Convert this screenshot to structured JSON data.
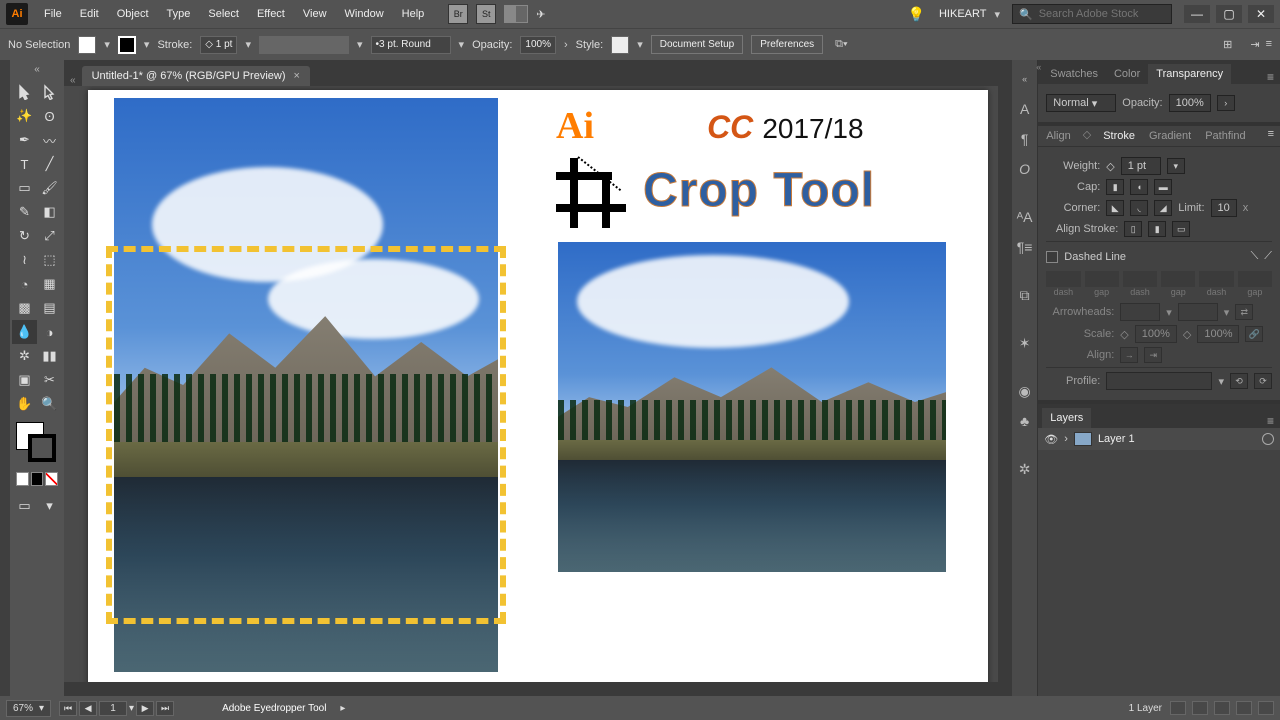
{
  "app": {
    "logo": "Ai"
  },
  "menu": [
    "File",
    "Edit",
    "Object",
    "Type",
    "Select",
    "Effect",
    "View",
    "Window",
    "Help"
  ],
  "user": "HIKEART",
  "search_placeholder": "Search Adobe Stock",
  "controlbar": {
    "selection": "No Selection",
    "stroke_label": "Stroke:",
    "stroke_val": "1 pt",
    "brush": "3 pt. Round",
    "opacity_label": "Opacity:",
    "opacity_val": "100%",
    "style_label": "Style:",
    "doc_setup": "Document Setup",
    "prefs": "Preferences"
  },
  "doc_tab": "Untitled-1* @ 67% (RGB/GPU Preview)",
  "artboard_text": {
    "ai": "Ai",
    "cc": "CC",
    "year": "2017/18",
    "crop_tool": "Crop Tool"
  },
  "status": {
    "zoom": "67%",
    "page": "1",
    "tool": "Adobe Eyedropper Tool",
    "layer_count": "1 Layer"
  },
  "panel_tabs_top": [
    "Swatches",
    "Color",
    "Transparency"
  ],
  "transparency": {
    "mode": "Normal",
    "opacity_label": "Opacity:",
    "opacity_val": "100%"
  },
  "stroke_sub_tabs": [
    "Align",
    "Stroke",
    "Gradient",
    "Pathfind"
  ],
  "stroke_panel": {
    "weight_label": "Weight:",
    "weight_val": "1 pt",
    "cap_label": "Cap:",
    "corner_label": "Corner:",
    "limit_label": "Limit:",
    "limit_val": "10",
    "align_label": "Align Stroke:",
    "dashed_label": "Dashed Line",
    "dash_labels": [
      "dash",
      "gap",
      "dash",
      "gap",
      "dash",
      "gap"
    ],
    "arrow_label": "Arrowheads:",
    "scale_label": "Scale:",
    "scale_val": "100%",
    "align_arrow": "Align:",
    "profile_label": "Profile:"
  },
  "layers": {
    "title": "Layers",
    "items": [
      {
        "name": "Layer 1"
      }
    ]
  }
}
